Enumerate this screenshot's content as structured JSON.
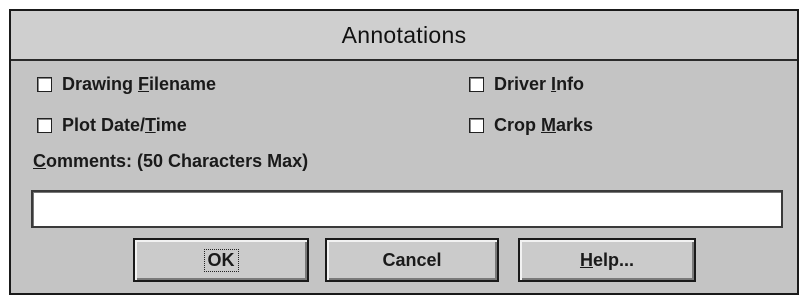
{
  "dialog": {
    "title": "Annotations"
  },
  "checkboxes": {
    "drawing_filename": {
      "pre": "Drawing ",
      "accel": "F",
      "post": "ilename",
      "checked": false
    },
    "driver_info": {
      "pre": "Driver ",
      "accel": "I",
      "post": "nfo",
      "checked": false
    },
    "plot_datetime": {
      "pre": "Plot Date/",
      "accel": "T",
      "post": "ime",
      "checked": false
    },
    "crop_marks": {
      "pre": "Crop ",
      "accel": "M",
      "post": "arks",
      "checked": false
    }
  },
  "comments": {
    "label_accel": "C",
    "label_rest": "omments: (50 Characters Max)",
    "value": ""
  },
  "buttons": {
    "ok": "OK",
    "cancel": "Cancel",
    "help_accel": "H",
    "help_rest": "elp..."
  }
}
